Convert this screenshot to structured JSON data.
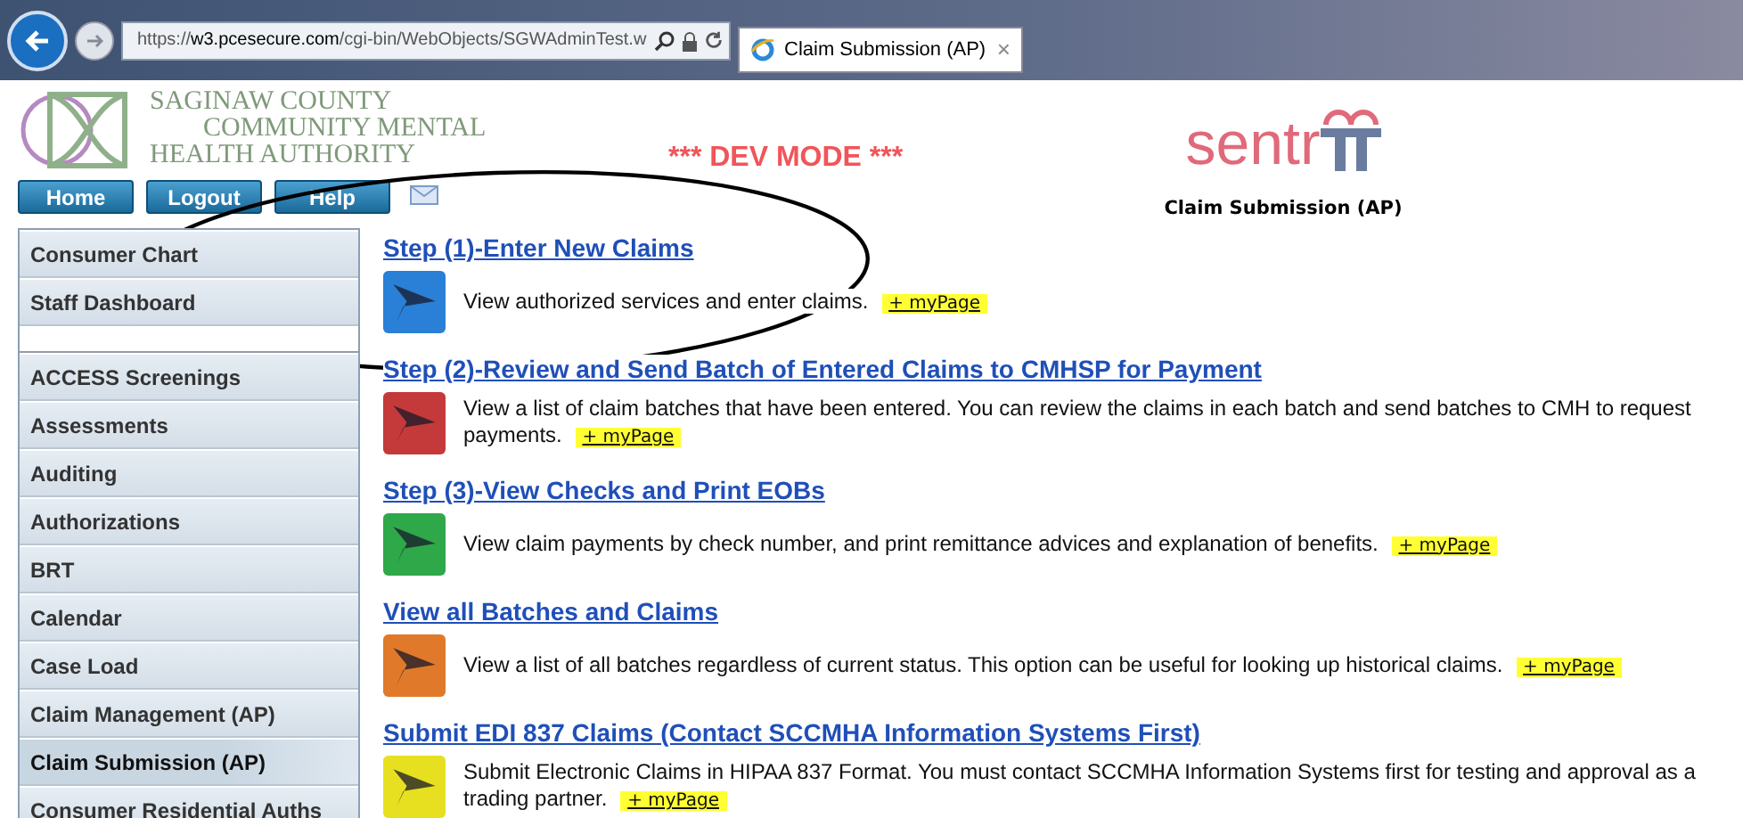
{
  "browser": {
    "url_scheme": "https://",
    "url_host": "w3.pcesecure.com",
    "url_path": "/cgi-bin/WebObjects/SGWAdminTest.w",
    "tab_title": "Claim Submission (AP)",
    "tab_close": "×"
  },
  "header": {
    "org_lines": [
      "SAGINAW COUNTY",
      "COMMUNITY MENTAL",
      "HEALTH AUTHORITY"
    ],
    "dev_mode": "*** DEV MODE ***",
    "nav_buttons": [
      "Home",
      "Logout",
      "Help"
    ],
    "logo_text": "sentr",
    "page_title": "Claim Submission (AP)"
  },
  "sidebar": {
    "groups": [
      [
        {
          "label": "Consumer Chart",
          "selected": false
        },
        {
          "label": "Staff Dashboard",
          "selected": false
        }
      ],
      [
        {
          "label": "ACCESS Screenings",
          "selected": false
        },
        {
          "label": "Assessments",
          "selected": false
        },
        {
          "label": "Auditing",
          "selected": false
        },
        {
          "label": "Authorizations",
          "selected": false
        },
        {
          "label": "BRT",
          "selected": false
        },
        {
          "label": "Calendar",
          "selected": false
        },
        {
          "label": "Case Load",
          "selected": false
        },
        {
          "label": "Claim Management (AP)",
          "selected": false
        },
        {
          "label": "Claim Submission (AP)",
          "selected": true
        },
        {
          "label": "Consumer Residential Auths",
          "selected": false
        }
      ]
    ]
  },
  "options": [
    {
      "title": "Step (1)-Enter New Claims",
      "description": "View authorized services and enter claims.",
      "mypage": "+ myPage",
      "color": "#2a7fd6"
    },
    {
      "title": "Step (2)-Review and Send Batch of Entered Claims to CMHSP for Payment",
      "description": "View a list of claim batches that have been entered. You can review the claims in each batch and send batches to CMH to request payments.",
      "mypage": "+ myPage",
      "color": "#c43a3a"
    },
    {
      "title": "Step (3)-View Checks and Print EOBs",
      "description": "View claim payments by check number, and print remittance advices and explanation of benefits.",
      "mypage": "+ myPage",
      "color": "#2fa84a"
    },
    {
      "title": "View all Batches and Claims",
      "description": "View a list of all batches regardless of current status. This option can be useful for looking up historical claims.",
      "mypage": "+ myPage",
      "color": "#e07a2a"
    },
    {
      "title": "Submit EDI 837 Claims (Contact SCCMHA Information Systems First)",
      "description": "Submit Electronic Claims in HIPAA 837 Format. You must contact SCCMHA Information Systems first for testing and approval as a trading partner.",
      "mypage": "+ myPage",
      "color": "#e6e020"
    }
  ]
}
